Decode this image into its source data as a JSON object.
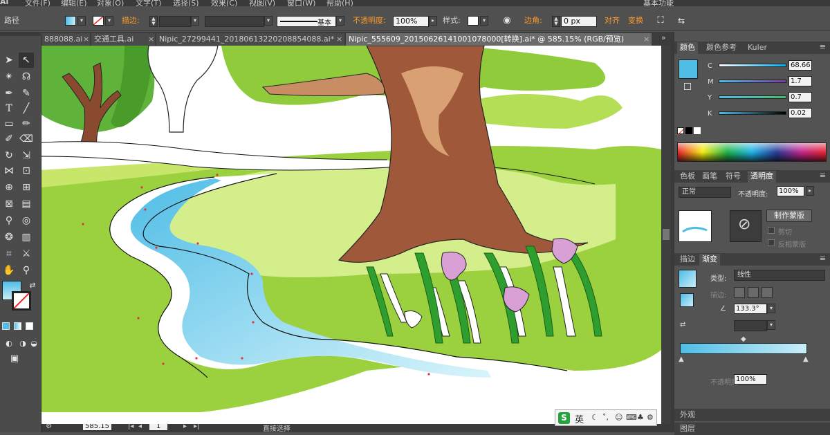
{
  "menubar": {
    "logo": "Ai",
    "items": [
      "文件(F)",
      "编辑(E)",
      "对象(O)",
      "文字(T)",
      "选择(S)",
      "效果(C)",
      "视图(V)",
      "窗口(W)",
      "帮助(H)"
    ],
    "workspace": "基本功能"
  },
  "controlbar": {
    "path_label": "路径",
    "stroke_label": "描边:",
    "stroke_style": "基本",
    "opacity_label": "不透明度:",
    "opacity_value": "100%",
    "style_label": "样式:",
    "corner_label": "边角:",
    "corner_value": "0 px",
    "align_label": "对齐",
    "transform_label": "变换"
  },
  "tabs": [
    {
      "label": "888088.ai"
    },
    {
      "label": "交通工具.ai"
    },
    {
      "label": "Nipic_27299441_20180613220208854088.ai*"
    },
    {
      "label": "Nipic_555609_20150626141001078000[转换].ai* @ 585.15% (RGB/预览)"
    }
  ],
  "color_panel": {
    "tabs": [
      "颜色",
      "颜色参考",
      "Kuler"
    ],
    "current_color": "#4fbde6",
    "sliders": [
      {
        "label": "C",
        "value": "68.66"
      },
      {
        "label": "M",
        "value": "1.7"
      },
      {
        "label": "Y",
        "value": "0.7"
      },
      {
        "label": "K",
        "value": "0.02"
      }
    ]
  },
  "transparency_panel": {
    "tabs": [
      "色板",
      "画笔",
      "符号",
      "透明度"
    ],
    "blend_mode": "正常",
    "opacity_label": "不透明度:",
    "opacity_value": "100%",
    "make_mask_button": "制作蒙版",
    "clip_label": "剪切",
    "invert_label": "反相蒙版"
  },
  "gradient_panel": {
    "tabs": [
      "描边",
      "渐变"
    ],
    "type_label": "类型:",
    "type_value": "线性",
    "stroke_label": "描边:",
    "angle_value": "133.3°",
    "opacity_label": "不透明度:",
    "opacity_value": "100%"
  },
  "bottom_tabs": {
    "appearance": "外观",
    "layers": "图层"
  },
  "statusbar": {
    "zoom": "585.15",
    "page": "1",
    "tool": "直接选择"
  },
  "ime": {
    "logo": "S",
    "lang": "英"
  },
  "colors": {
    "accent_orange": "#ff9c2a",
    "gradient_start": "#4fbde6",
    "gradient_end": "#c9eef8"
  }
}
